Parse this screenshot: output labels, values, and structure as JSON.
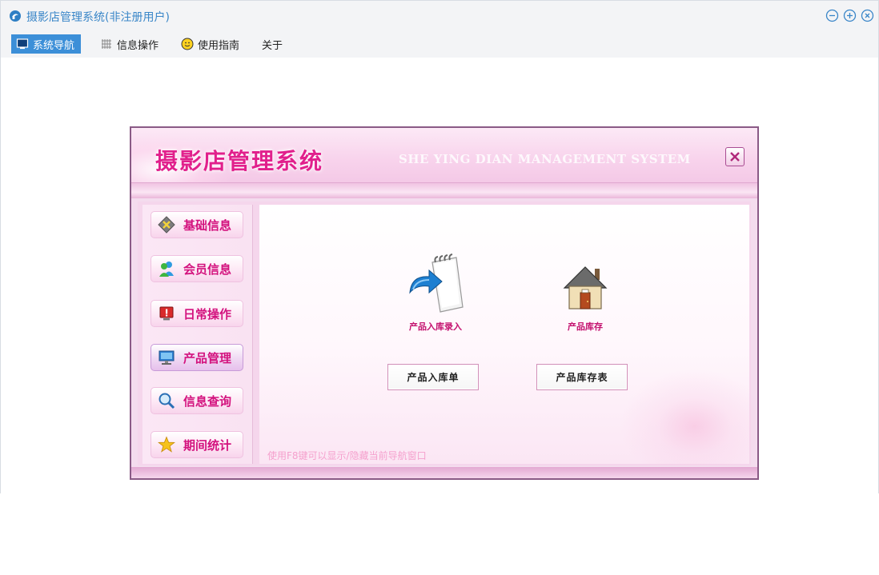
{
  "window": {
    "title": "摄影店管理系统(非注册用户)"
  },
  "menubar": {
    "items": [
      {
        "label": "系统导航",
        "icon": "monitor-icon",
        "active": true
      },
      {
        "label": "信息操作",
        "icon": "grid-icon",
        "active": false
      },
      {
        "label": "使用指南",
        "icon": "smiley-icon",
        "active": false
      },
      {
        "label": "关于",
        "icon": "",
        "active": false
      }
    ]
  },
  "dialog": {
    "title": "摄影店管理系统",
    "subtitle": "SHE YING DIAN MANAGEMENT SYSTEM",
    "sidebar": {
      "items": [
        {
          "label": "基础信息",
          "icon": "diamond-tools-icon",
          "active": false
        },
        {
          "label": "会员信息",
          "icon": "users-icon",
          "active": false
        },
        {
          "label": "日常操作",
          "icon": "alert-icon",
          "active": false
        },
        {
          "label": "产品管理",
          "icon": "monitor-icon",
          "active": true
        },
        {
          "label": "信息查询",
          "icon": "magnifier-icon",
          "active": false
        },
        {
          "label": "期间统计",
          "icon": "star-icon",
          "active": false
        }
      ]
    },
    "content": {
      "features": [
        {
          "label": "产品入库录入",
          "icon": "notepad-arrow-icon"
        },
        {
          "label": "产品库存",
          "icon": "house-icon"
        }
      ],
      "buttons": [
        {
          "label": "产品入库单"
        },
        {
          "label": "产品库存表"
        }
      ],
      "hint": "使用F8键可以显示/隐藏当前导航窗口"
    }
  },
  "colors": {
    "accent_blue": "#3c8fd8",
    "title_blue": "#3a86c8",
    "brand_pink": "#e1208c",
    "label_pink": "#c4126f",
    "hint_pink": "#f5a0cd"
  }
}
